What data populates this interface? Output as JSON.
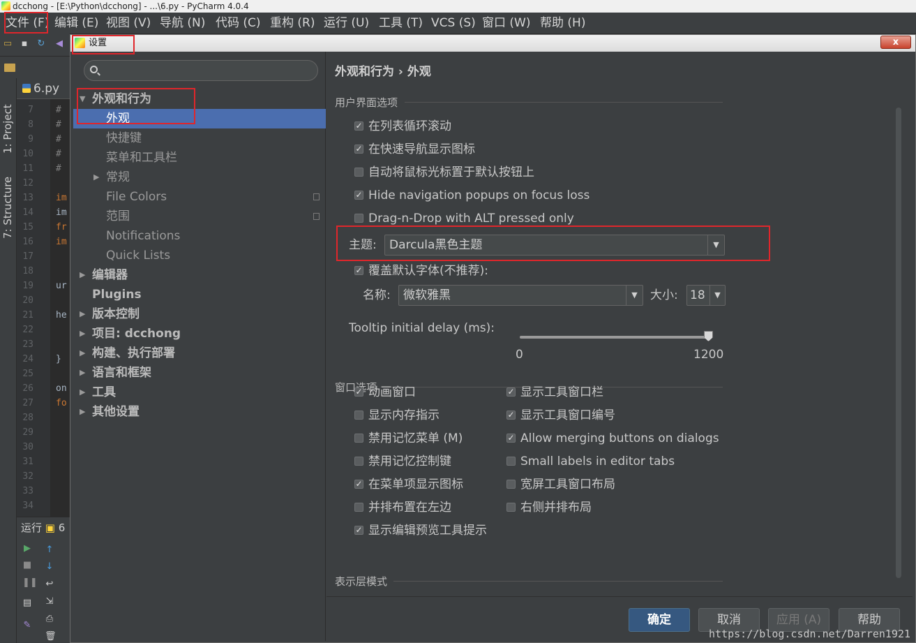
{
  "ide": {
    "window_title": "dcchong - [E:\\Python\\dcchong] - ...\\6.py - PyCharm 4.0.4",
    "menu": [
      "文件 (F)",
      "编辑 (E)",
      "视图 (V)",
      "导航 (N)",
      "代码 (C)",
      "重构 (R)",
      "运行 (U)",
      "工具 (T)",
      "VCS (S)",
      "窗口 (W)",
      "帮助 (H)"
    ],
    "breadcrumb": "dcchong",
    "editor_tab": "6.py",
    "toolwindows": {
      "project": "1: Project",
      "structure": "7: Structure"
    },
    "line_numbers": [
      "7",
      "8",
      "9",
      "10",
      "11",
      "12",
      "13",
      "14",
      "15",
      "16",
      "17",
      "18",
      "19",
      "20",
      "21",
      "22",
      "23",
      "24",
      "25",
      "26",
      "27",
      "28",
      "29",
      "30",
      "31",
      "32",
      "33",
      "34"
    ],
    "code_lines": [
      {
        "line": 0,
        "text": "#",
        "color": "#808080"
      },
      {
        "line": 1,
        "text": "#",
        "color": "#808080"
      },
      {
        "line": 2,
        "text": "#",
        "color": "#808080"
      },
      {
        "line": 3,
        "text": "#",
        "color": "#808080"
      },
      {
        "line": 4,
        "text": "#",
        "color": "#808080"
      },
      {
        "line": 6,
        "text": "im",
        "color": "#cc7832"
      },
      {
        "line": 7,
        "text": "im",
        "color": "#a9b7c6"
      },
      {
        "line": 8,
        "text": "fr",
        "color": "#cc7832"
      },
      {
        "line": 9,
        "text": "im",
        "color": "#cc7832"
      },
      {
        "line": 12,
        "text": "ur",
        "color": "#a9b7c6"
      },
      {
        "line": 14,
        "text": "he",
        "color": "#a9b7c6"
      },
      {
        "line": 17,
        "text": "}",
        "color": "#a9b7c6"
      },
      {
        "line": 19,
        "text": "on",
        "color": "#a9b7c6"
      },
      {
        "line": 20,
        "text": "fo",
        "color": "#cc7832"
      }
    ],
    "run_panel": {
      "title": "运行",
      "tab": "6"
    }
  },
  "dialog": {
    "title": "设置",
    "close_label": "x",
    "search": {
      "value": "",
      "placeholder": ""
    },
    "tree": [
      {
        "label": "外观和行为",
        "level": 0,
        "expanded": true,
        "bold": true
      },
      {
        "label": "外观",
        "level": 1,
        "selected": true
      },
      {
        "label": "快捷键",
        "level": 1
      },
      {
        "label": "菜单和工具栏",
        "level": 1
      },
      {
        "label": "常规",
        "level": 1,
        "expandable": true
      },
      {
        "label": "File Colors",
        "level": 1,
        "copy_icon": true
      },
      {
        "label": "范围",
        "level": 1,
        "copy_icon": true
      },
      {
        "label": "Notifications",
        "level": 1
      },
      {
        "label": "Quick Lists",
        "level": 1
      },
      {
        "label": "编辑器",
        "level": 0,
        "expandable": true,
        "bold": true
      },
      {
        "label": "Plugins",
        "level": 0,
        "bold": true
      },
      {
        "label": "版本控制",
        "level": 0,
        "expandable": true,
        "bold": true
      },
      {
        "label": "项目: dcchong",
        "level": 0,
        "expandable": true,
        "bold": true
      },
      {
        "label": "构建、执行部署",
        "level": 0,
        "expandable": true,
        "bold": true
      },
      {
        "label": "语言和框架",
        "level": 0,
        "expandable": true,
        "bold": true
      },
      {
        "label": "工具",
        "level": 0,
        "expandable": true,
        "bold": true
      },
      {
        "label": "其他设置",
        "level": 0,
        "expandable": true,
        "bold": true
      }
    ],
    "content": {
      "breadcrumb": "外观和行为 › 外观",
      "ui_options": {
        "title": "用户界面选项",
        "checkboxes": [
          {
            "label": "在列表循环滚动",
            "checked": true
          },
          {
            "label": "在快速导航显示图标",
            "checked": true
          },
          {
            "label": "自动将鼠标光标置于默认按钮上",
            "checked": false
          },
          {
            "label": "Hide navigation popups on focus loss",
            "checked": true
          },
          {
            "label": "Drag-n-Drop with ALT pressed only",
            "checked": false
          }
        ],
        "theme": {
          "label": "主题:",
          "value": "Darcula黑色主题"
        },
        "override_font": {
          "label": "覆盖默认字体(不推荐):",
          "checked": true
        },
        "font_name": {
          "label": "名称:",
          "value": "微软雅黑"
        },
        "font_size": {
          "label": "大小:",
          "value": "18"
        },
        "tooltip": {
          "label": "Tooltip initial delay (ms):",
          "min": "0",
          "max": "1200",
          "value": 1200
        }
      },
      "window_options": {
        "title": "窗口选项",
        "left": [
          {
            "label": "动画窗口",
            "checked": true
          },
          {
            "label": "显示内存指示",
            "checked": false
          },
          {
            "label": "禁用记忆菜单 (M)",
            "checked": false
          },
          {
            "label": "禁用记忆控制键",
            "checked": false
          },
          {
            "label": "在菜单项显示图标",
            "checked": true
          },
          {
            "label": "并排布置在左边",
            "checked": false
          },
          {
            "label": "显示编辑预览工具提示",
            "checked": true
          }
        ],
        "right": [
          {
            "label": "显示工具窗口栏",
            "checked": true
          },
          {
            "label": "显示工具窗口编号",
            "checked": true
          },
          {
            "label": "Allow merging buttons on dialogs",
            "checked": true
          },
          {
            "label": "Small labels in editor tabs",
            "checked": false
          },
          {
            "label": "宽屏工具窗口布局",
            "checked": false
          },
          {
            "label": "右侧并排布局",
            "checked": false
          }
        ]
      },
      "presentation": {
        "title": "表示层模式"
      }
    },
    "buttons": {
      "ok": "确定",
      "cancel": "取消",
      "apply": "应用 (A)",
      "help": "帮助"
    }
  },
  "watermark": "https://blog.csdn.net/Darren1921",
  "colors": {
    "highlight": "#e0262b",
    "selection": "#4b6eaf",
    "primary_button": "#365880"
  }
}
